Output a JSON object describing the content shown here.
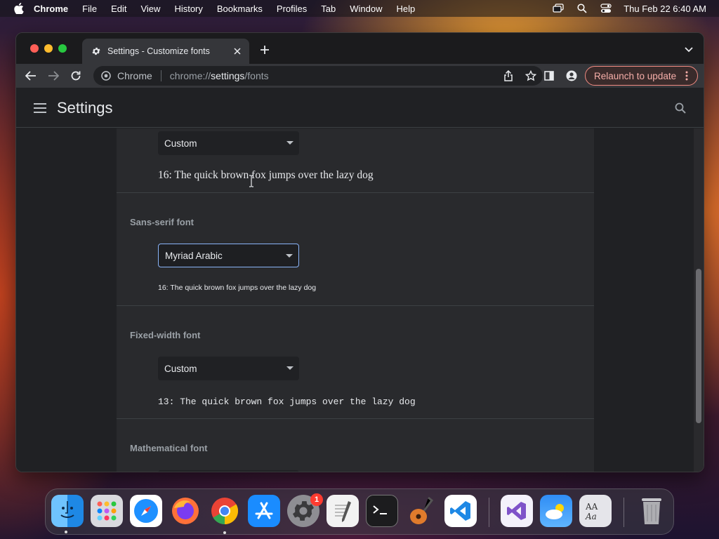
{
  "menubar": {
    "app_name": "Chrome",
    "items": [
      "File",
      "Edit",
      "View",
      "History",
      "Bookmarks",
      "Profiles",
      "Tab",
      "Window",
      "Help"
    ],
    "clock": "Thu Feb 22  6:40 AM",
    "icons": [
      "apple-icon",
      "screen-mirroring-icon",
      "spotlight-search-icon",
      "control-center-icon"
    ]
  },
  "browser": {
    "tab_title": "Settings - Customize fonts",
    "omnibox": {
      "chip_label": "Chrome",
      "url_scheme": "chrome://",
      "url_host": "settings",
      "url_path": "/fonts"
    },
    "relaunch_label": "Relaunch to update"
  },
  "settings": {
    "title": "Settings",
    "sections": [
      {
        "label": "",
        "selected": "Custom",
        "sample": "16: The quick brown fox jumps over the lazy dog"
      },
      {
        "label": "Sans-serif font",
        "selected": "Myriad Arabic",
        "sample": "16: The quick brown fox jumps over the lazy dog"
      },
      {
        "label": "Fixed-width font",
        "selected": "Custom",
        "sample": "13: The quick brown fox jumps over the lazy dog"
      },
      {
        "label": "Mathematical font"
      }
    ]
  },
  "dock": {
    "apps": [
      "Finder",
      "Launchpad",
      "Safari",
      "Firefox",
      "Google Chrome",
      "App Store",
      "System Settings",
      "TextEdit",
      "Terminal",
      "GarageBand",
      "Visual Studio Code",
      "Visual Studio",
      "Weather",
      "Font Book",
      "Trash"
    ],
    "system_settings_badge": "1"
  },
  "colors": {
    "accent": "#8ab4f8",
    "relaunch": "#f28b82",
    "page_bg": "#202124",
    "card_bg": "#292a2d"
  }
}
